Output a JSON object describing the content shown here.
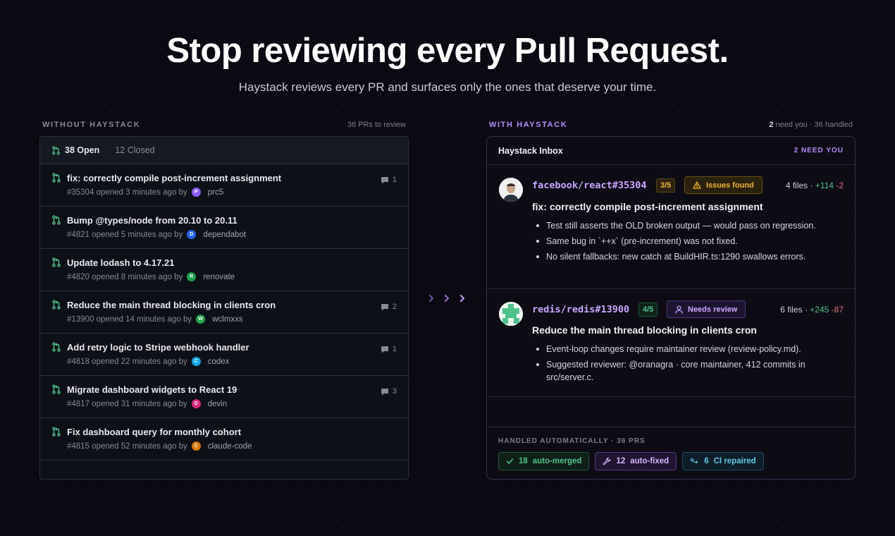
{
  "hero": {
    "title": "Stop reviewing every Pull Request.",
    "subtitle": "Haystack reviews every PR and surfaces only the ones that deserve your time."
  },
  "without": {
    "label": "WITHOUT HAYSTACK",
    "meta": "38 PRs to review",
    "open_tab": "38 Open",
    "closed_tab": "12 Closed",
    "rows": [
      {
        "title": "fix: correctly compile post-increment assignment",
        "meta": "#35304 opened 3 minutes ago by",
        "avatar": "P",
        "avatar_color": "#8b5cf6",
        "author": "prc5",
        "comments": "1"
      },
      {
        "title": "Bump @types/node from 20.10 to 20.11",
        "meta": "#4821 opened 5 minutes ago by",
        "avatar": "D",
        "avatar_color": "#2563eb",
        "author": "dependabot",
        "comments": ""
      },
      {
        "title": "Update lodash to 4.17.21",
        "meta": "#4820 opened 8 minutes ago by",
        "avatar": "R",
        "avatar_color": "#16a34a",
        "author": "renovate",
        "comments": ""
      },
      {
        "title": "Reduce the main thread blocking in clients cron",
        "meta": "#13900 opened 14 minutes ago by",
        "avatar": "W",
        "avatar_color": "#22a34a",
        "author": "wclmxxs",
        "comments": "2"
      },
      {
        "title": "Add retry logic to Stripe webhook handler",
        "meta": "#4818 opened 22 minutes ago by",
        "avatar": "C",
        "avatar_color": "#0ea5e9",
        "author": "codex",
        "comments": "1"
      },
      {
        "title": "Migrate dashboard widgets to React 19",
        "meta": "#4817 opened 31 minutes ago by",
        "avatar": "D",
        "avatar_color": "#db2777",
        "author": "devin",
        "comments": "3"
      },
      {
        "title": "Fix dashboard query for monthly cohort",
        "meta": "#4815 opened 52 minutes ago by",
        "avatar": "C",
        "avatar_color": "#d97706",
        "author": "claude-code",
        "comments": ""
      }
    ]
  },
  "with": {
    "label": "WITH HAYSTACK",
    "meta_count": "2",
    "meta_text": " need you · 36 handled",
    "inbox_title": "Haystack Inbox",
    "inbox_badge": "2 NEED YOU",
    "cards": [
      {
        "repo": "facebook/react#35304",
        "score": "3/5",
        "status": "Issues found",
        "files": "4 files · ",
        "plus": "+114",
        "minus": "-2",
        "title": "fix: correctly compile post-increment assignment",
        "bullets": [
          "Test still asserts the OLD broken output — would pass on regression.",
          "Same bug in `++x` (pre-increment) was not fixed.",
          "No silent fallbacks: new catch at BuildHIR.ts:1290 swallows errors."
        ]
      },
      {
        "repo": "redis/redis#13900",
        "score": "4/5",
        "status": "Needs review",
        "files": "6 files · ",
        "plus": "+245",
        "minus": "-87",
        "title": "Reduce the main thread blocking in clients cron",
        "bullets": [
          "Event-loop changes require maintainer review (review-policy.md).",
          "Suggested reviewer: @oranagra · core maintainer, 412 commits in src/server.c."
        ]
      }
    ],
    "handled_label": "HANDLED AUTOMATICALLY · 36 PRS",
    "chips": [
      {
        "count": "18",
        "label": "auto-merged"
      },
      {
        "count": "12",
        "label": "auto-fixed"
      },
      {
        "count": "6",
        "label": "CI repaired"
      }
    ]
  },
  "colors": {
    "accent_purple": "#b38cff",
    "green": "#4cc38a",
    "red": "#e5707a",
    "warning": "#f0b429"
  }
}
